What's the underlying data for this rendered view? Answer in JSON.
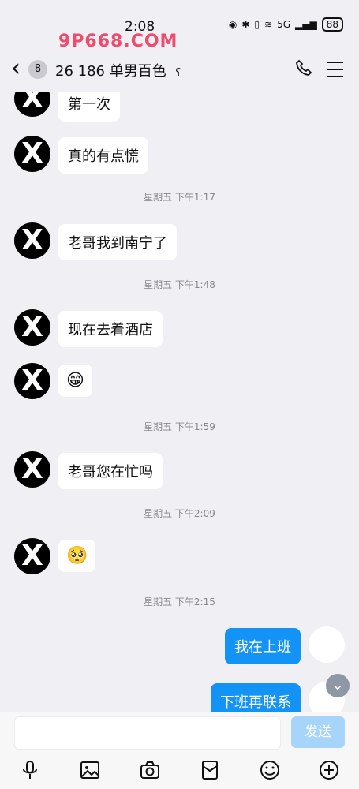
{
  "status_bar": {
    "time": "2:08",
    "battery": "88",
    "signal": "5G"
  },
  "watermark": "9P668.COM",
  "header": {
    "back_badge": "8",
    "title": "26 186 单男百色",
    "ear_icon": "ear-icon"
  },
  "messages": [
    {
      "type": "in",
      "text": "第一次"
    },
    {
      "type": "in",
      "text": "真的有点慌"
    },
    {
      "type": "time",
      "text": "星期五 下午1:17"
    },
    {
      "type": "in",
      "text": "老哥我到南宁了"
    },
    {
      "type": "time",
      "text": "星期五 下午1:48"
    },
    {
      "type": "in",
      "text": "现在去着酒店"
    },
    {
      "type": "in",
      "text": "😁"
    },
    {
      "type": "time",
      "text": "星期五 下午1:59"
    },
    {
      "type": "in",
      "text": "老哥您在忙吗"
    },
    {
      "type": "time",
      "text": "星期五 下午2:09"
    },
    {
      "type": "in",
      "text": "🥺"
    },
    {
      "type": "time",
      "text": "星期五 下午2:15"
    },
    {
      "type": "out",
      "text": "我在上班"
    },
    {
      "type": "out",
      "text": "下班再联系"
    }
  ],
  "avatar_glyph": "X",
  "composer": {
    "placeholder": "",
    "send_label": "发送"
  },
  "toolbar_icons": [
    "microphone-icon",
    "image-icon",
    "camera-icon",
    "red-packet-icon",
    "emoji-icon",
    "plus-icon"
  ]
}
